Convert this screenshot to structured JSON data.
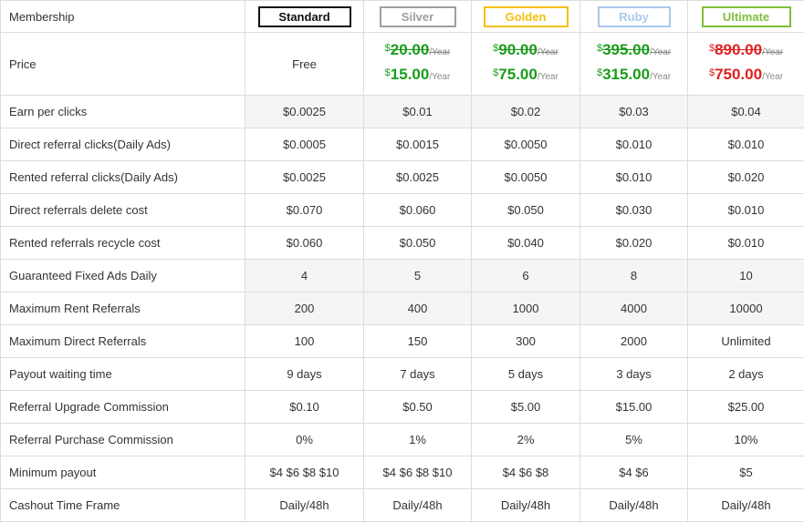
{
  "header": {
    "label": "Membership",
    "plans": [
      "Standard",
      "Silver",
      "Golden",
      "Ruby",
      "Ultimate"
    ]
  },
  "colors": {
    "standard": "#111111",
    "silver": "#9e9e9e",
    "golden": "#f2c00a",
    "ruby": "#a9c8ec",
    "ultimate": "#7fbf3a",
    "price_green": "#1a9c1a",
    "price_red": "#e02020"
  },
  "price": {
    "label": "Price",
    "standard": "Free",
    "currency": "$",
    "per": "/Year",
    "silver": {
      "old": "20.00",
      "new": "15.00"
    },
    "golden": {
      "old": "90.00",
      "new": "75.00"
    },
    "ruby": {
      "old": "395.00",
      "new": "315.00"
    },
    "ultimate": {
      "old": "890.00",
      "new": "750.00"
    }
  },
  "rows": [
    {
      "label": "Earn per clicks",
      "values": [
        "$0.0025",
        "$0.01",
        "$0.02",
        "$0.03",
        "$0.04"
      ]
    },
    {
      "label": "Direct referral clicks(Daily Ads)",
      "values": [
        "$0.0005",
        "$0.0015",
        "$0.0050",
        "$0.010",
        "$0.010"
      ]
    },
    {
      "label": "Rented referral clicks(Daily Ads)",
      "values": [
        "$0.0025",
        "$0.0025",
        "$0.0050",
        "$0.010",
        "$0.020"
      ]
    },
    {
      "label": "Direct referrals delete cost",
      "values": [
        "$0.070",
        "$0.060",
        "$0.050",
        "$0.030",
        "$0.010"
      ]
    },
    {
      "label": "Rented referrals recycle cost",
      "values": [
        "$0.060",
        "$0.050",
        "$0.040",
        "$0.020",
        "$0.010"
      ]
    },
    {
      "label": "Guaranteed Fixed Ads Daily",
      "values": [
        "4",
        "5",
        "6",
        "8",
        "10"
      ]
    },
    {
      "label": "Maximum Rent Referrals",
      "values": [
        "200",
        "400",
        "1000",
        "4000",
        "10000"
      ]
    },
    {
      "label": "Maximum Direct Referrals",
      "values": [
        "100",
        "150",
        "300",
        "2000",
        "Unlimited"
      ]
    },
    {
      "label": "Payout waiting time",
      "values": [
        "9 days",
        "7 days",
        "5 days",
        "3 days",
        "2 days"
      ]
    },
    {
      "label": "Referral Upgrade Commission",
      "values": [
        "$0.10",
        "$0.50",
        "$5.00",
        "$15.00",
        "$25.00"
      ]
    },
    {
      "label": "Referral Purchase Commission",
      "values": [
        "0%",
        "1%",
        "2%",
        "5%",
        "10%"
      ]
    },
    {
      "label": "Minimum payout",
      "values": [
        "$4 $6 $8 $10",
        "$4 $6 $8 $10",
        "$4 $6 $8",
        "$4 $6",
        "$5"
      ]
    },
    {
      "label": "Cashout Time Frame",
      "values": [
        "Daily/48h",
        "Daily/48h",
        "Daily/48h",
        "Daily/48h",
        "Daily/48h"
      ]
    }
  ]
}
